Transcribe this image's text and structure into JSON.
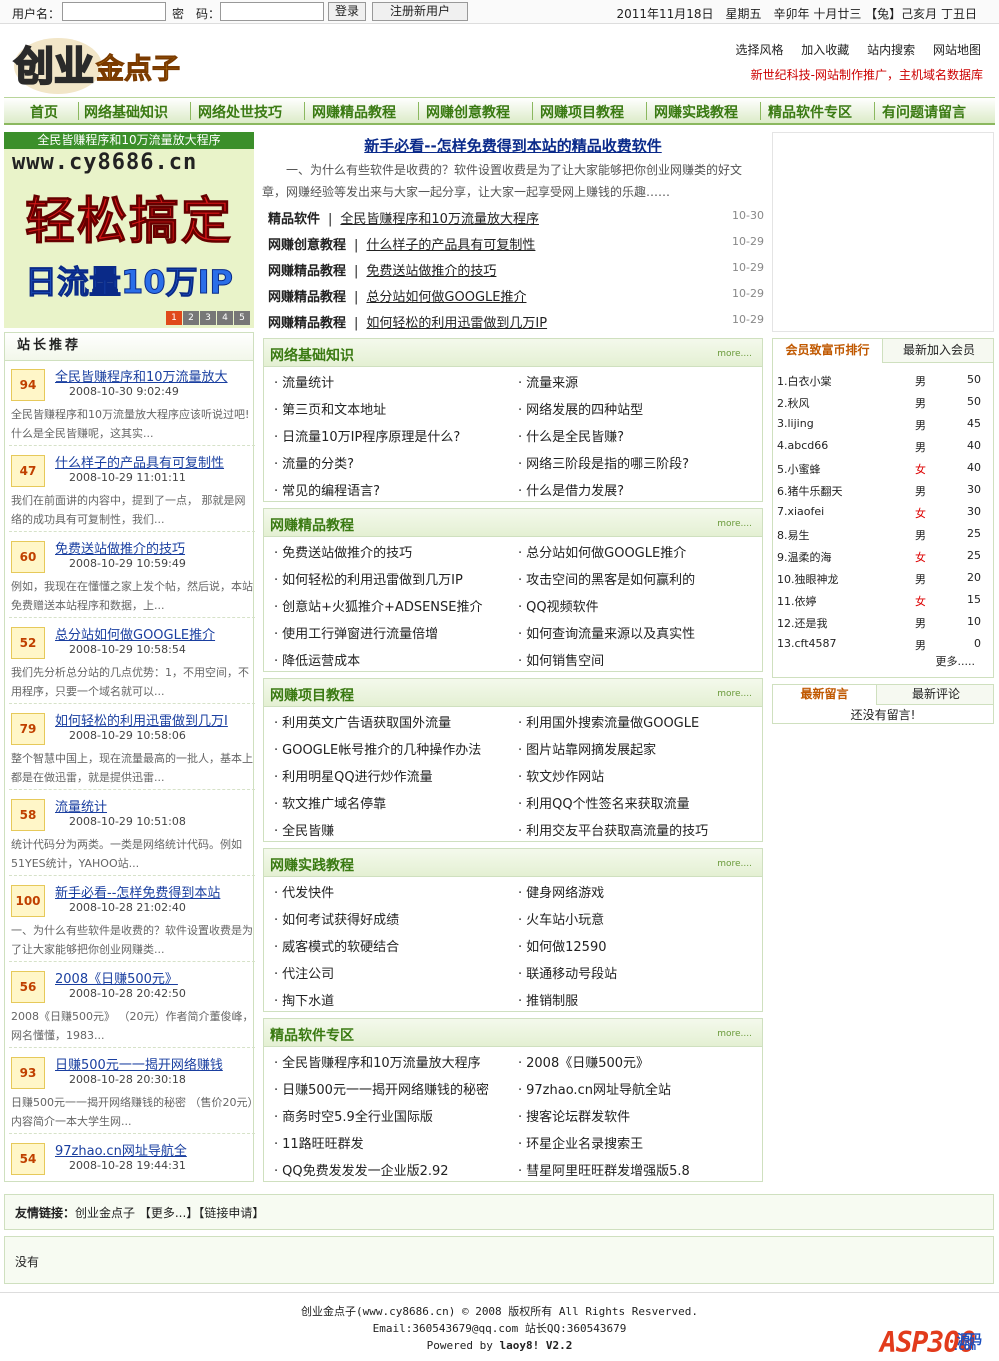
{
  "topbar": {
    "user_label": "用户名：",
    "pwd_label": "密　码：",
    "login": "登录",
    "register": "注册新用户",
    "date": "2011年11月18日　星期五　辛卯年 十月廿三 【兔】己亥月 丁丑日"
  },
  "header": {
    "logo_text": "创业金点子",
    "links": [
      "选择风格",
      "加入收藏",
      "站内搜索",
      "网站地图"
    ],
    "slogan": "新世纪科技-网站制作推广，主机域名数据库"
  },
  "nav": [
    "首页",
    "网络基础知识",
    "网络处世技巧",
    "网赚精品教程",
    "网赚创意教程",
    "网赚项目教程",
    "网赚实践教程",
    "精品软件专区",
    "有问题请留言"
  ],
  "banner": {
    "caption": "全民皆赚程序和10万流量放大程序",
    "url": "www.cy8686.cn",
    "line1": "轻松搞定",
    "line2": "日流量10万IP",
    "pages": [
      "1",
      "2",
      "3",
      "4",
      "5"
    ]
  },
  "zztj": {
    "title": "站长推荐",
    "items": [
      {
        "score": "94",
        "title": "全民皆赚程序和10万流量放大",
        "date": "2008-10-30 9:02:49",
        "desc": "全民皆赚程序和10万流量放大程序应该听说过吧!什么是全民皆赚呢，这其实..."
      },
      {
        "score": "47",
        "title": "什么样子的产品具有可复制性",
        "date": "2008-10-29 11:01:11",
        "desc": "我们在前面讲的内容中，提到了一点， 那就是网络的成功具有可复制性，我们..."
      },
      {
        "score": "60",
        "title": "免费送站做推介的技巧",
        "date": "2008-10-29 10:59:49",
        "desc": "例如，我现在在懂懂之家上发个帖，然后说，本站免费赠送本站程序和数据，上..."
      },
      {
        "score": "52",
        "title": "总分站如何做GOOGLE推介",
        "date": "2008-10-29 10:58:54",
        "desc": "我们先分析总分站的几点优势：1，不用空间，不用程序，只要一个域名就可以..."
      },
      {
        "score": "79",
        "title": "如何轻松的利用迅雷做到几万I",
        "date": "2008-10-29 10:58:06",
        "desc": "整个智慧中国上，现在流量最高的一批人，基本上都是在做迅雷，就是提供迅雷..."
      },
      {
        "score": "58",
        "title": "流量统计",
        "date": "2008-10-29 10:51:08",
        "desc": "统计代码分为两类。一类是网络统计代码。例如51YES统计，YAHOO站..."
      },
      {
        "score": "100",
        "title": "新手必看--怎样免费得到本站",
        "date": "2008-10-28 21:02:40",
        "desc": "一、为什么有些软件是收费的？软件设置收费是为了让大家能够把你创业网赚类..."
      },
      {
        "score": "56",
        "title": "2008《日赚500元》",
        "date": "2008-10-28 20:42:50",
        "desc": "2008《日赚500元》 （20元）作者简介董俊峰，网名懂懂，1983..."
      },
      {
        "score": "93",
        "title": "日赚500元一一揭开网络赚钱",
        "date": "2008-10-28 20:30:18",
        "desc": "日赚500元一一揭开网络赚钱的秘密 （售价20元）内容简介一本大学生网..."
      },
      {
        "score": "54",
        "title": "97zhao.cn网址导航全",
        "date": "2008-10-28 19:44:31",
        "desc": ""
      }
    ]
  },
  "main": {
    "headline": "新手必看--怎样免费得到本站的精品收费软件",
    "intro": "一、为什么有些软件是收费的？软件设置收费是为了让大家能够把你创业网赚类的好文章，网赚经验等发出来与大家一起分享，让大家一起享受网上赚钱的乐趣……",
    "news": [
      {
        "cat": "精品软件",
        "title": "全民皆赚程序和10万流量放大程序",
        "date": "10-30"
      },
      {
        "cat": "网赚创意教程",
        "title": "什么样子的产品具有可复制性",
        "date": "10-29"
      },
      {
        "cat": "网赚精品教程",
        "title": "免费送站做推介的技巧",
        "date": "10-29"
      },
      {
        "cat": "网赚精品教程",
        "title": "总分站如何做GOOGLE推介",
        "date": "10-29"
      },
      {
        "cat": "网赚精品教程",
        "title": "如何轻松的利用迅雷做到几万IP",
        "date": "10-29"
      }
    ],
    "more": "more....",
    "sections": [
      {
        "title": "网络基础知识",
        "items": [
          "流量统计",
          "流量来源",
          "第三页和文本地址",
          "网络发展的四种站型",
          "日流量10万IP程序原理是什么?",
          "什么是全民皆赚?",
          "流量的分类?",
          "网络三阶段是指的哪三阶段?",
          "常见的编程语言?",
          "什么是借力发展?"
        ]
      },
      {
        "title": "网赚精品教程",
        "items": [
          "免费送站做推介的技巧",
          "总分站如何做GOOGLE推介",
          "如何轻松的利用迅雷做到几万IP",
          "攻击空间的黑客是如何赢利的",
          "创意站+火狐推介+ADSENSE推介",
          "QQ视频软件",
          "使用工行弹窗进行流量倍增",
          "如何查询流量来源以及真实性",
          "降低运营成本",
          "如何销售空间"
        ]
      },
      {
        "title": "网赚项目教程",
        "items": [
          "利用英文广告语获取国外流量",
          "利用国外搜索流量做GOOGLE",
          "GOOGLE帐号推介的几种操作办法",
          "图片站靠网摘发展起家",
          "利用明星QQ进行炒作流量",
          "软文炒作网站",
          "软文推广域名停靠",
          "利用QQ个性签名来获取流量",
          "全民皆赚",
          "利用交友平台获取高流量的技巧"
        ]
      },
      {
        "title": "网赚实践教程",
        "items": [
          "代发快件",
          "健身网络游戏",
          "如何考试获得好成绩",
          "火车站小玩意",
          "威客模式的软硬结合",
          "如何做12590",
          "代注公司",
          "联通移动号段站",
          "掏下水道",
          "推销制服"
        ]
      },
      {
        "title": "精品软件专区",
        "items": [
          "全民皆赚程序和10万流量放大程序",
          "2008《日赚500元》",
          "日赚500元一一揭开网络赚钱的秘密",
          "97zhao.cn网址导航全站",
          "商务时空5.9全行业国际版",
          "搜客论坛群发软件",
          "11路旺旺群发",
          "环星企业名录搜索王",
          "QQ免费发发发一企业版2.92",
          "彗星阿里旺旺群发增强版5.8"
        ]
      }
    ]
  },
  "rank": {
    "tab1": "会员致富币排行",
    "tab2": "最新加入会员",
    "rows": [
      {
        "name": "1.白衣小棠",
        "gender": "男",
        "score": "50"
      },
      {
        "name": "2.秋风",
        "gender": "男",
        "score": "50"
      },
      {
        "name": "3.lijing",
        "gender": "男",
        "score": "45"
      },
      {
        "name": "4.abcd66",
        "gender": "男",
        "score": "40"
      },
      {
        "name": "5.小蜜蜂",
        "gender": "女",
        "score": "40"
      },
      {
        "name": "6.猪牛乐翻天",
        "gender": "男",
        "score": "30"
      },
      {
        "name": "7.xiaofei",
        "gender": "女",
        "score": "30"
      },
      {
        "name": "8.易生",
        "gender": "男",
        "score": "25"
      },
      {
        "name": "9.温柔的海",
        "gender": "女",
        "score": "25"
      },
      {
        "name": "10.独眼神龙",
        "gender": "男",
        "score": "20"
      },
      {
        "name": "11.依婷",
        "gender": "女",
        "score": "15"
      },
      {
        "name": "12.还是我",
        "gender": "男",
        "score": "10"
      },
      {
        "name": "13.cft4587",
        "gender": "男",
        "score": "0"
      }
    ],
    "more": "更多....."
  },
  "msg": {
    "tab1": "最新留言",
    "tab2": "最新评论",
    "empty": "还没有留言!"
  },
  "friend": {
    "label": "友情链接：",
    "link": "创业金点子",
    "more": "【更多...】",
    "apply": "【链接申请】"
  },
  "nothing": "没有",
  "footer": {
    "line1": "创业金点子(www.cy8686.cn) © 2008 版权所有 All Rights Resverved.",
    "line2": "Email:360543679@qq.com 站长QQ:360543679",
    "line3_prefix": "Powered by ",
    "line3_brand": "laoy8! V2.2"
  },
  "watermark": {
    "brand": "ASP300",
    "sub": "源码",
    "com": ".com"
  }
}
